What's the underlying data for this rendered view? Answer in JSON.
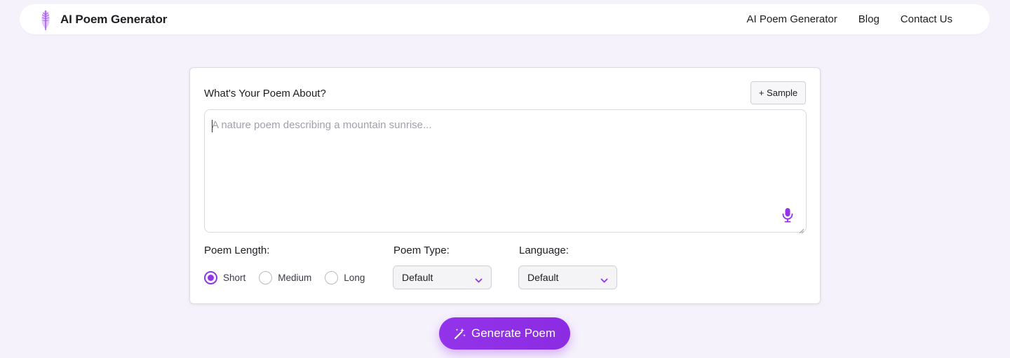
{
  "navbar": {
    "brand_name": "AI Poem Generator",
    "logo_icon": "feather-quill-icon",
    "links": [
      {
        "label": "AI Poem Generator"
      },
      {
        "label": "Blog"
      },
      {
        "label": "Contact Us"
      }
    ]
  },
  "form": {
    "prompt_label": "What's Your Poem About?",
    "sample_button": "+ Sample",
    "prompt_value": "",
    "prompt_placeholder": "A nature poem describing a mountain sunrise...",
    "mic_icon": "microphone-icon",
    "length": {
      "label": "Poem Length:",
      "options": [
        {
          "label": "Short",
          "checked": true
        },
        {
          "label": "Medium",
          "checked": false
        },
        {
          "label": "Long",
          "checked": false
        }
      ]
    },
    "type": {
      "label": "Poem Type:",
      "value": "Default"
    },
    "language": {
      "label": "Language:",
      "value": "Default"
    },
    "generate_button": "Generate Poem",
    "generate_icon": "magic-wand-icon"
  },
  "colors": {
    "accent": "#9333ea",
    "background": "#f6f2fc",
    "card": "#ffffff"
  }
}
